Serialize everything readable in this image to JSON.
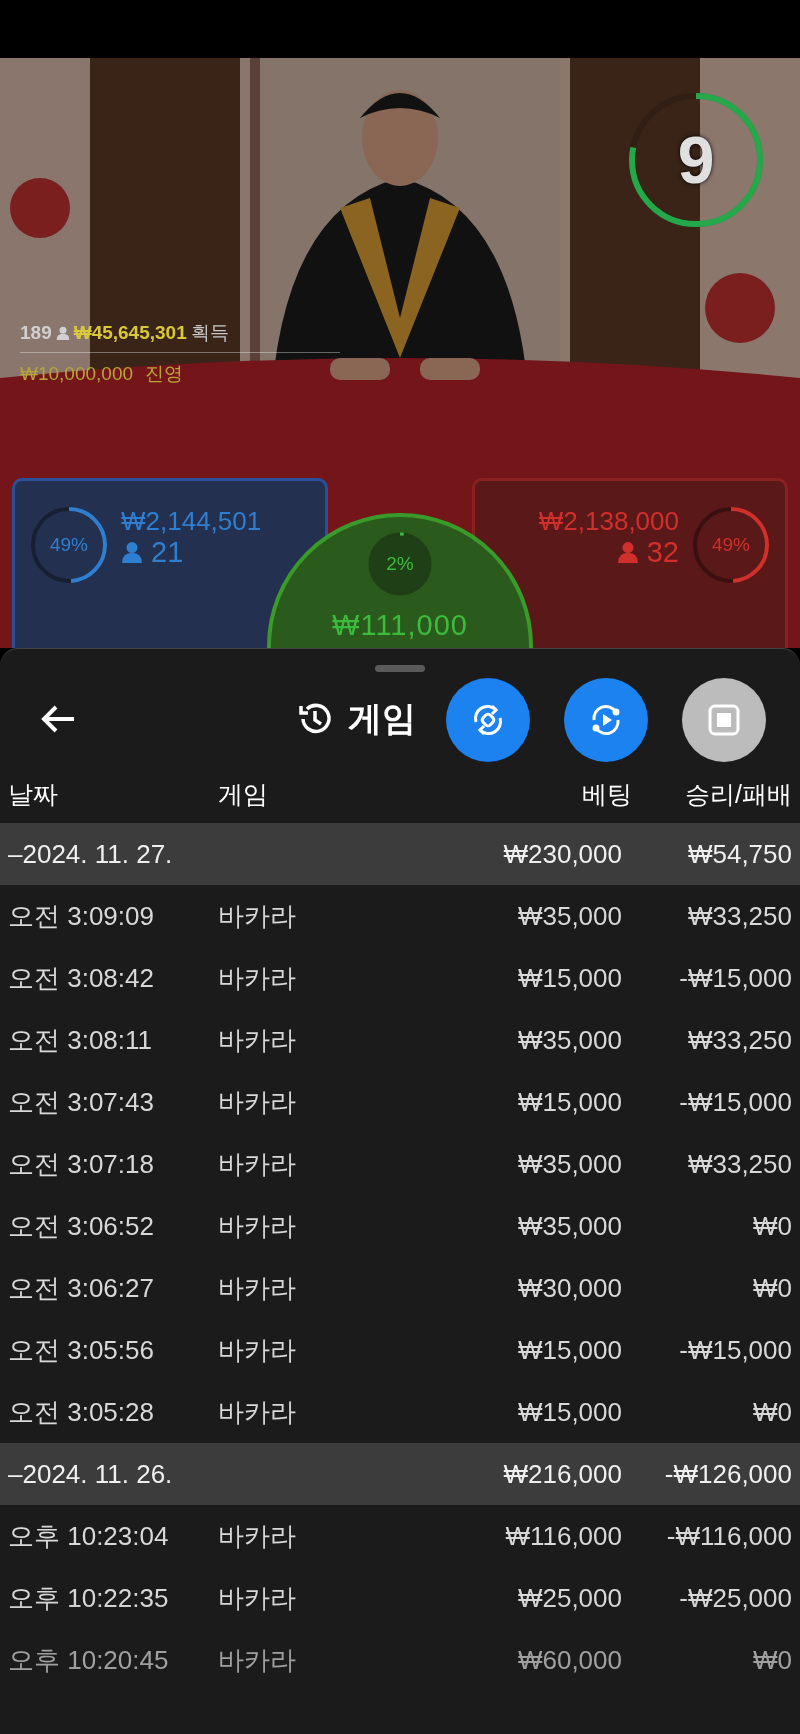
{
  "timer": {
    "count": "9",
    "level": 0.78
  },
  "table_stats": {
    "players": "189",
    "won_amount": "₩45,645,301",
    "won_label": "획득",
    "limit_amount": "₩10,000,000",
    "limit_label": "진영"
  },
  "bets": [
    {
      "kind": "player",
      "percent": "49%",
      "level": 0.49,
      "amount": "₩2,144,501",
      "players": "21"
    },
    {
      "kind": "tie",
      "percent": "2%",
      "level": 0.02,
      "amount": "₩111,000"
    },
    {
      "kind": "banker",
      "percent": "49%",
      "level": 0.49,
      "amount": "₩2,138,000",
      "players": "32"
    }
  ],
  "sheet": {
    "title": "게임",
    "actions": [
      {
        "kind": "rotate",
        "disabled": false
      },
      {
        "kind": "replay",
        "disabled": false
      },
      {
        "kind": "stop",
        "disabled": true
      }
    ],
    "columns": [
      "날짜",
      "게임",
      "베팅",
      "승리/패배"
    ],
    "groups": [
      {
        "date": "–2024. 11. 27.",
        "bet": "₩230,000",
        "result": "₩54,750",
        "rows": [
          {
            "time": "오전 3:09:09",
            "game": "바카라",
            "bet": "₩35,000",
            "result": "₩33,250"
          },
          {
            "time": "오전 3:08:42",
            "game": "바카라",
            "bet": "₩15,000",
            "result": "-₩15,000"
          },
          {
            "time": "오전 3:08:11",
            "game": "바카라",
            "bet": "₩35,000",
            "result": "₩33,250"
          },
          {
            "time": "오전 3:07:43",
            "game": "바카라",
            "bet": "₩15,000",
            "result": "-₩15,000"
          },
          {
            "time": "오전 3:07:18",
            "game": "바카라",
            "bet": "₩35,000",
            "result": "₩33,250"
          },
          {
            "time": "오전 3:06:52",
            "game": "바카라",
            "bet": "₩35,000",
            "result": "₩0"
          },
          {
            "time": "오전 3:06:27",
            "game": "바카라",
            "bet": "₩30,000",
            "result": "₩0"
          },
          {
            "time": "오전 3:05:56",
            "game": "바카라",
            "bet": "₩15,000",
            "result": "-₩15,000"
          },
          {
            "time": "오전 3:05:28",
            "game": "바카라",
            "bet": "₩15,000",
            "result": "₩0"
          }
        ]
      },
      {
        "date": "–2024. 11. 26.",
        "bet": "₩216,000",
        "result": "-₩126,000",
        "rows": [
          {
            "time": "오후 10:23:04",
            "game": "바카라",
            "bet": "₩116,000",
            "result": "-₩116,000"
          },
          {
            "time": "오후 10:22:35",
            "game": "바카라",
            "bet": "₩25,000",
            "result": "-₩25,000"
          },
          {
            "time": "오후 10:20:45",
            "game": "바카라",
            "bet": "₩60,000",
            "result": "₩0"
          }
        ]
      }
    ]
  }
}
